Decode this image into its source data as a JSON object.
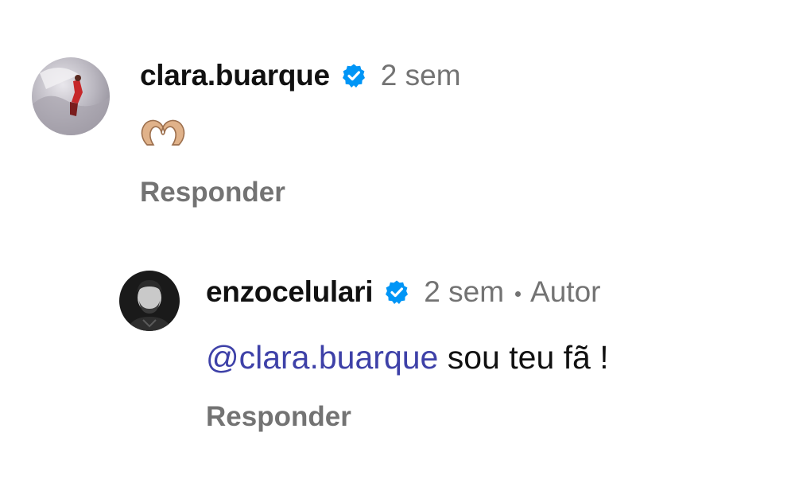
{
  "comments": [
    {
      "username": "clara.buarque",
      "verified": true,
      "time": "2 sem",
      "body_emoji": "heart-hands",
      "reply_label": "Responder",
      "avatar_icon": "profile-photo"
    }
  ],
  "reply": {
    "username": "enzocelulari",
    "verified": true,
    "time": "2 sem",
    "separator": "•",
    "author_badge": "Autor",
    "mention": "@clara.buarque",
    "text": " sou teu fã !",
    "reply_label": "Responder",
    "avatar_icon": "profile-photo"
  },
  "colors": {
    "verified_blue": "#0095f6",
    "mention": "#3e41a8",
    "secondary_text": "#737373"
  }
}
